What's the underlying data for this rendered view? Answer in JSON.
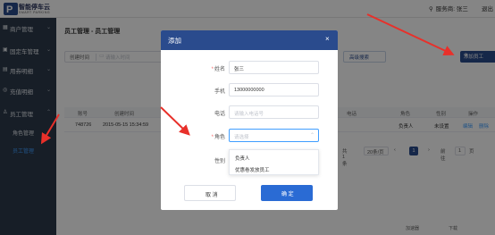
{
  "header": {
    "app_name": "智能停车云",
    "app_sub": "SMART PARKING",
    "user_label": "服务商: 张三",
    "exit_label": "退出"
  },
  "sidebar": {
    "items": [
      {
        "label": "商户管理",
        "icon": "shop-icon"
      },
      {
        "label": "固定车管理",
        "icon": "car-icon"
      },
      {
        "label": "用券明细",
        "icon": "ticket-icon"
      },
      {
        "label": "充值明细",
        "icon": "recharge-icon"
      },
      {
        "label": "员工管理",
        "icon": "staff-icon"
      }
    ],
    "subitems": [
      {
        "label": "角色管理"
      },
      {
        "label": "员工管理"
      }
    ]
  },
  "main": {
    "breadcrumb": "员工管理 - 员工管理",
    "filter": {
      "label": "创建时间",
      "placeholder": "请输入时间"
    },
    "adv_search_label": "高级搜索",
    "add_button_label": "添加员工",
    "table": {
      "columns": [
        "账号",
        "创建时间",
        "电话",
        "角色",
        "性别",
        "操作"
      ],
      "rows": [
        {
          "account": "748726",
          "created": "2015-05-15 15:34:59",
          "role": "负责人",
          "gender": "未设置",
          "action_edit": "编辑",
          "action_delete": "删除"
        }
      ]
    },
    "pager": {
      "total": "共 1 条",
      "page_size": "20条/页",
      "current": "1",
      "goto_label": "前往",
      "goto_value": "1",
      "page_unit": "页"
    }
  },
  "statusbar": {
    "speed_label": "加速器",
    "download_label": "下载"
  },
  "dialog": {
    "title": "添加",
    "fields": {
      "name": {
        "label": "姓名",
        "value": "张三"
      },
      "phone": {
        "label": "手机",
        "value": "13000000000"
      },
      "tel": {
        "label": "电话",
        "placeholder": "请输入电话号"
      },
      "role": {
        "label": "角色",
        "placeholder": "请选择"
      },
      "gender": {
        "label": "性别"
      }
    },
    "role_options": [
      "负责人",
      "优惠卷发放员工"
    ],
    "cancel_label": "取 消",
    "ok_label": "确 定"
  },
  "colors": {
    "primary": "#2a4b8d",
    "sidebar_bg": "#2d3a4b",
    "active_link": "#409eff",
    "required": "#f56c6c",
    "annotation": "#e8302a"
  }
}
